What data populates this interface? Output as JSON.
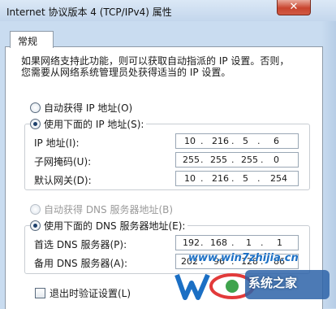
{
  "window": {
    "title": "Internet 协议版本 4 (TCP/IPv4) 属性",
    "close_glyph": "✕"
  },
  "tabs": [
    {
      "label": "常规",
      "selected": true
    }
  ],
  "description": {
    "line1": "如果网络支持此功能，则可以获取自动指派的 IP 设置。否则，",
    "line2": "您需要从网络系统管理员处获得适当的 IP 设置。"
  },
  "ip_mode": {
    "auto_label": "自动获得 IP 地址(O)",
    "manual_label": "使用下面的 IP 地址(S):",
    "selected": "manual"
  },
  "ip_fields": {
    "ip_address": {
      "label": "IP 地址(I):",
      "octets": [
        "10",
        "216",
        "5",
        "6"
      ]
    },
    "subnet_mask": {
      "label": "子网掩码(U):",
      "octets": [
        "255",
        "255",
        "255",
        "0"
      ]
    },
    "default_gateway": {
      "label": "默认网关(D):",
      "octets": [
        "10",
        "216",
        "5",
        "254"
      ]
    }
  },
  "dns_mode": {
    "auto_label": "自动获得 DNS 服务器地址(B)",
    "manual_label": "使用下面的 DNS 服务器地址(E):",
    "selected": "manual"
  },
  "dns_fields": {
    "preferred": {
      "label": "首选 DNS 服务器(P):",
      "octets": [
        "192",
        "168",
        "1",
        "1"
      ]
    },
    "alternate": {
      "label": "备用 DNS 服务器(A):",
      "octets": [
        "202",
        "96",
        "128",
        "86"
      ]
    }
  },
  "validate_on_exit": {
    "label": "退出时验证设置(L)",
    "checked": false
  },
  "watermark": {
    "url": "www.win7zhijia.cn",
    "brand": "系统之家"
  },
  "colors": {
    "accent": "#1c3f6b",
    "watermark_blue": "#1b6fc4",
    "close_red": "#c8452f"
  }
}
